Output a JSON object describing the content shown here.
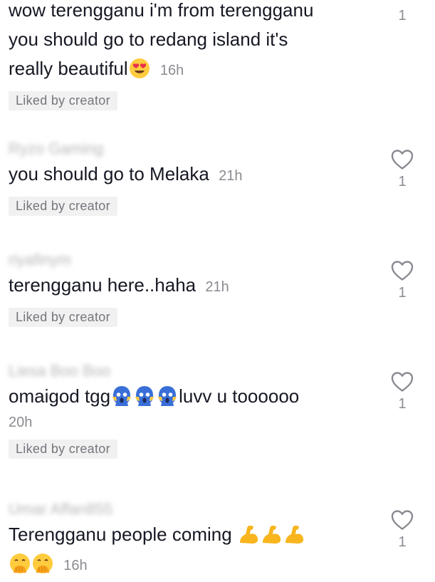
{
  "comments": [
    {
      "username": "",
      "line1": "wow terengganu i'm from terengganu",
      "line2": "you should go to redang island it's",
      "line3": "really beautiful",
      "emoji": [
        "heart-eyes-emoji"
      ],
      "time": "16h",
      "badge": "Liked by creator",
      "likes": "1"
    },
    {
      "username": "Ryzo Gaming",
      "text": "you should go to Melaka",
      "time": "21h",
      "badge": "Liked by creator",
      "likes": "1"
    },
    {
      "username": "riyafinym",
      "text": "terengganu here..haha",
      "time": "21h",
      "badge": "Liked by creator",
      "likes": "1"
    },
    {
      "username": "Liesa Boo Boo",
      "text_before": "omaigod tgg",
      "emoji": [
        "scream-emoji",
        "scream-emoji",
        "scream-emoji"
      ],
      "text_after": "luvv u toooooo",
      "time": "20h",
      "badge": "Liked by creator",
      "likes": "1"
    },
    {
      "username": "Umar Affan855",
      "text": "Terengganu people coming",
      "emoji_line1": [
        "flexed-biceps-emoji",
        "flexed-biceps-emoji",
        "flexed-biceps-emoji"
      ],
      "emoji_line2": [
        "hand-over-mouth-emoji",
        "hand-over-mouth-emoji"
      ],
      "time": "16h",
      "likes": "1"
    }
  ],
  "colors": {
    "text": "#161823",
    "secondary": "#8a8b91",
    "badge_bg": "#f1f1f2",
    "heart_stroke": "#8a8b91"
  }
}
